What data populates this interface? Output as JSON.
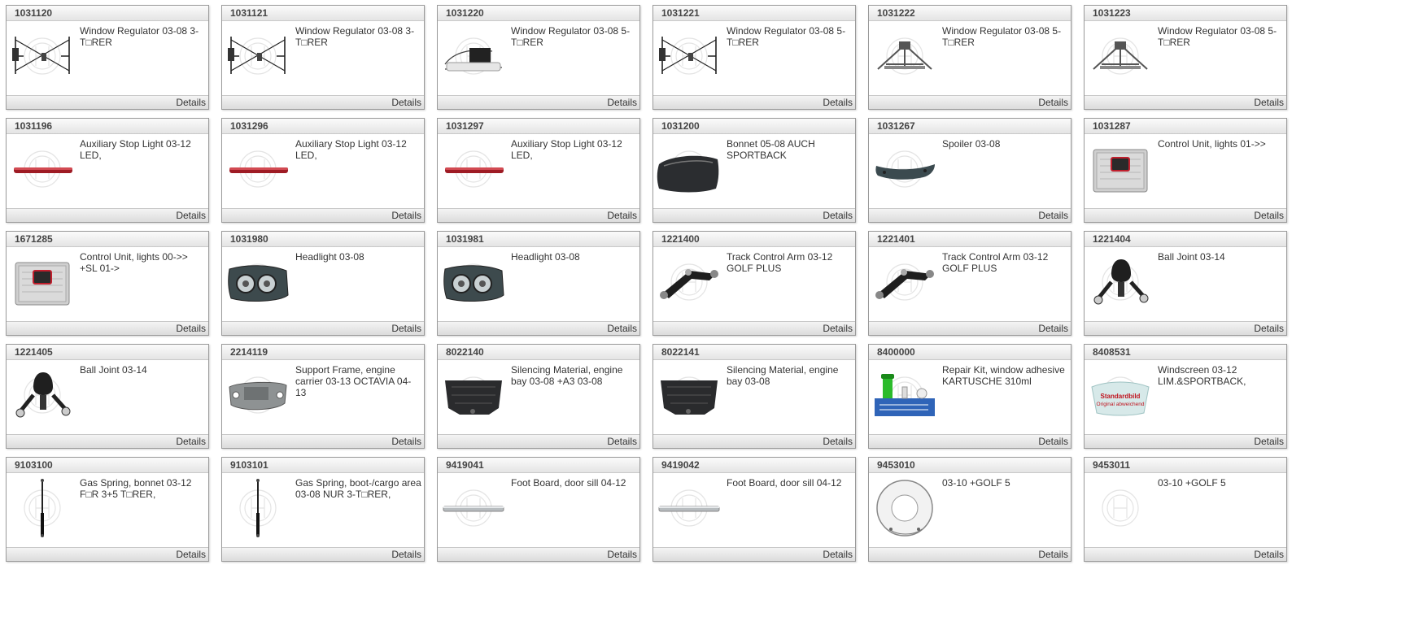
{
  "details_label": "Details",
  "placeholder": {
    "line1": "Standardbild",
    "line2": "Original abweichend"
  },
  "items": [
    {
      "id": "1031120",
      "title": "Window Regulator 03-08 3-T□RER",
      "icon": "window-regulator-icon"
    },
    {
      "id": "1031121",
      "title": "Window Regulator 03-08 3-T□RER",
      "icon": "window-regulator-icon"
    },
    {
      "id": "1031220",
      "title": "Window Regulator 03-08 5-T□RER",
      "icon": "window-regulator-motor-icon"
    },
    {
      "id": "1031221",
      "title": "Window Regulator 03-08 5-T□RER",
      "icon": "window-regulator-icon"
    },
    {
      "id": "1031222",
      "title": "Window Regulator 03-08 5-T□RER",
      "icon": "window-regulator-arm-icon"
    },
    {
      "id": "1031223",
      "title": "Window Regulator 03-08 5-T□RER",
      "icon": "window-regulator-arm-icon"
    },
    {
      "id": "1031196",
      "title": "Auxiliary Stop Light 03-12 LED,",
      "icon": "stop-light-icon"
    },
    {
      "id": "1031296",
      "title": "Auxiliary Stop Light 03-12 LED,",
      "icon": "stop-light-icon"
    },
    {
      "id": "1031297",
      "title": "Auxiliary Stop Light 03-12 LED,",
      "icon": "stop-light-icon"
    },
    {
      "id": "1031200",
      "title": "Bonnet 05-08 AUCH SPORTBACK",
      "icon": "bonnet-icon"
    },
    {
      "id": "1031267",
      "title": "Spoiler 03-08",
      "icon": "spoiler-icon"
    },
    {
      "id": "1031287",
      "title": "Control Unit, lights 01->>",
      "icon": "control-unit-icon"
    },
    {
      "id": "1671285",
      "title": "Control Unit, lights 00->> +SL 01->",
      "icon": "control-unit-icon"
    },
    {
      "id": "1031980",
      "title": "Headlight 03-08",
      "icon": "headlight-icon"
    },
    {
      "id": "1031981",
      "title": "Headlight 03-08",
      "icon": "headlight-icon"
    },
    {
      "id": "1221400",
      "title": "Track Control Arm 03-12 GOLF PLUS",
      "icon": "control-arm-icon"
    },
    {
      "id": "1221401",
      "title": "Track Control Arm 03-12 GOLF PLUS",
      "icon": "control-arm-icon"
    },
    {
      "id": "1221404",
      "title": "Ball Joint 03-14",
      "icon": "ball-joint-icon"
    },
    {
      "id": "1221405",
      "title": "Ball Joint 03-14",
      "icon": "ball-joint-icon"
    },
    {
      "id": "2214119",
      "title": "Support Frame, engine carrier 03-13 OCTAVIA 04-13",
      "icon": "support-frame-icon"
    },
    {
      "id": "8022140",
      "title": "Silencing Material, engine bay 03-08 +A3 03-08",
      "icon": "engine-cover-icon"
    },
    {
      "id": "8022141",
      "title": "Silencing Material, engine bay 03-08",
      "icon": "engine-cover-icon"
    },
    {
      "id": "8400000",
      "title": "Repair Kit, window adhesive KARTUSCHE 310ml",
      "icon": "repair-kit-icon"
    },
    {
      "id": "8408531",
      "title": "Windscreen 03-12 LIM.&SPORTBACK,",
      "icon": "windscreen-icon"
    },
    {
      "id": "9103100",
      "title": "Gas Spring, bonnet 03-12 F□R 3+5 T□RER,",
      "icon": "gas-spring-icon"
    },
    {
      "id": "9103101",
      "title": "Gas Spring, boot-/cargo area 03-08 NUR 3-T□RER,",
      "icon": "gas-spring-icon"
    },
    {
      "id": "9419041",
      "title": "Foot Board, door sill 04-12",
      "icon": "foot-board-icon"
    },
    {
      "id": "9419042",
      "title": "Foot Board, door sill 04-12",
      "icon": "foot-board-icon"
    },
    {
      "id": "9453010",
      "title": "03-10 +GOLF 5",
      "icon": "splash-guard-icon"
    },
    {
      "id": "9453011",
      "title": "03-10 +GOLF 5",
      "icon": "no-image-icon"
    }
  ]
}
